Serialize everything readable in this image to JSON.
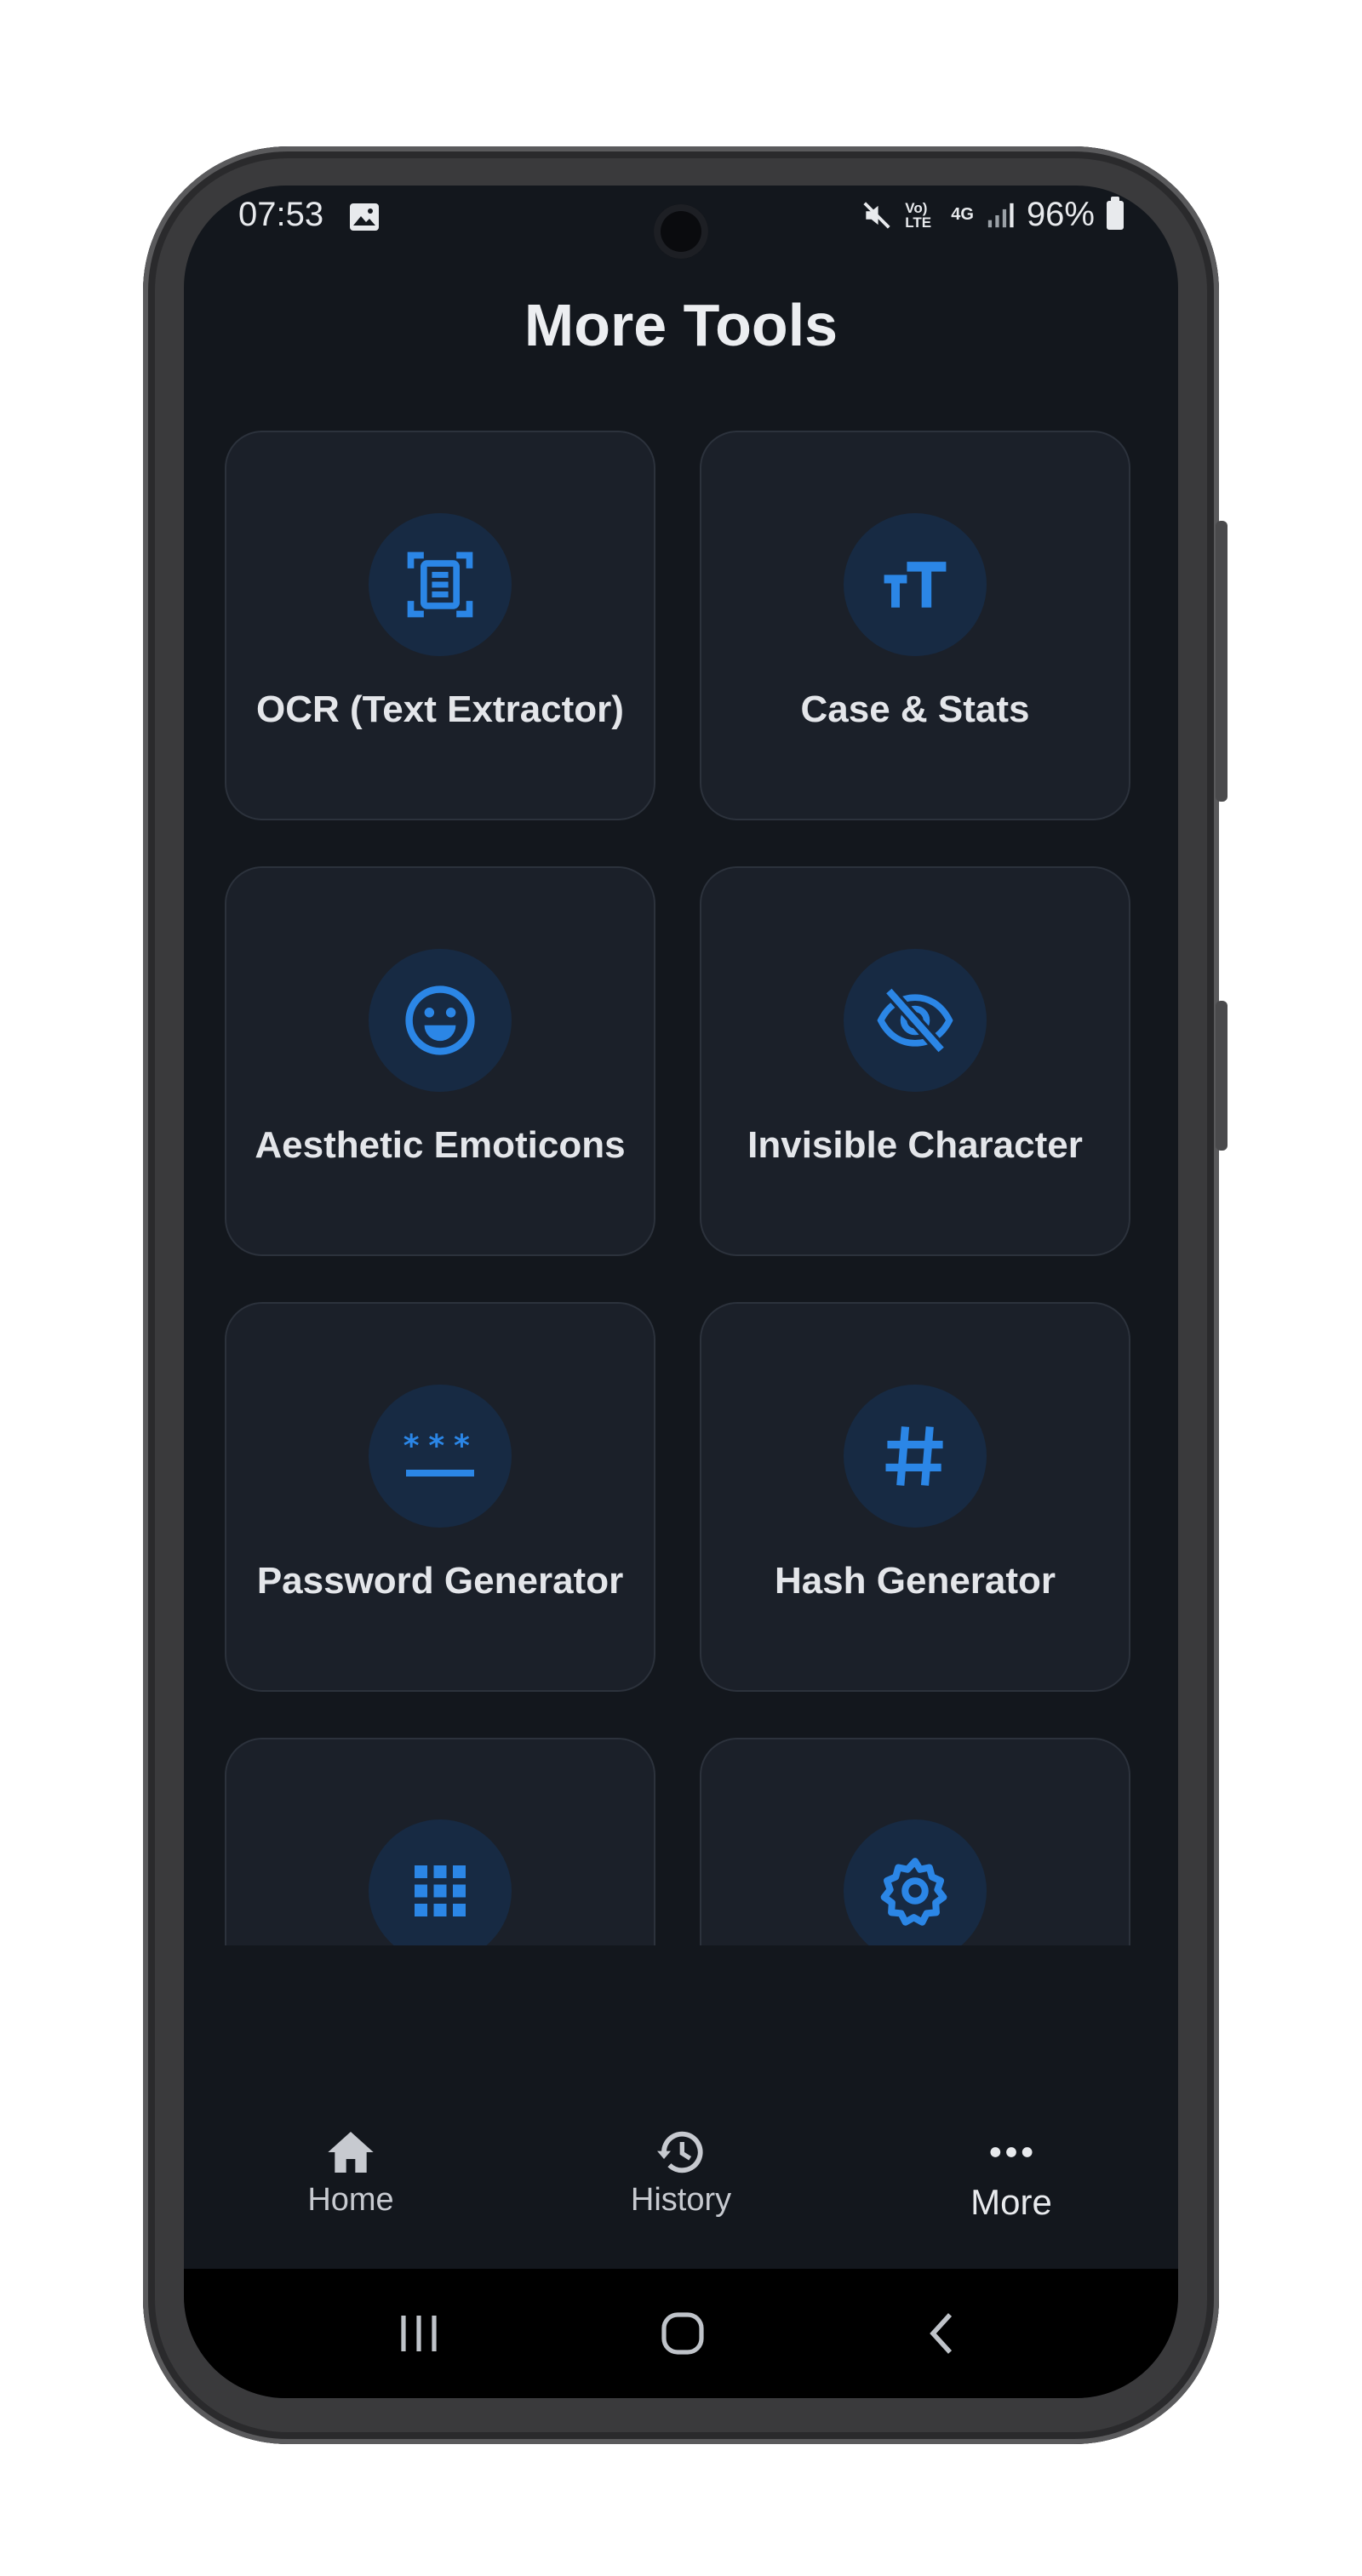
{
  "status": {
    "time": "07:53",
    "battery": "96%",
    "network": "4G",
    "volte": "Vo) LTE"
  },
  "header": {
    "title": "More Tools"
  },
  "tools": [
    {
      "label": "OCR (Text Extractor)",
      "icon": "document-scan-icon"
    },
    {
      "label": "Case & Stats",
      "icon": "text-size-icon"
    },
    {
      "label": "Aesthetic Emoticons",
      "icon": "smiley-icon"
    },
    {
      "label": "Invisible Character",
      "icon": "eye-off-icon"
    },
    {
      "label": "Password Generator",
      "icon": "password-icon"
    },
    {
      "label": "Hash Generator",
      "icon": "hash-icon"
    },
    {
      "label": "",
      "icon": "grid-apps-icon"
    },
    {
      "label": "",
      "icon": "gear-icon"
    }
  ],
  "nav": {
    "home": "Home",
    "history": "History",
    "more": "More"
  },
  "colors": {
    "accent": "#2b86e6",
    "background": "#13171d",
    "card": "#1b2029",
    "icon_bg": "#172a43"
  }
}
